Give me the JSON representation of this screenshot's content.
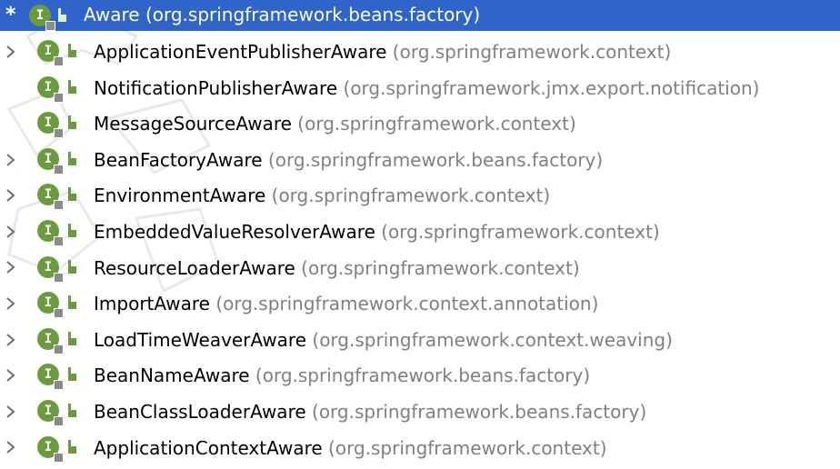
{
  "colors": {
    "selection": "#2f65ca",
    "interface_icon": "#6a9b3c",
    "package_text": "#808080"
  },
  "icons": {
    "chevron": "chevron-right-icon",
    "interface": "interface-icon",
    "visibility": "public-visibility-icon",
    "root_marker": "asterisk-icon"
  },
  "root": {
    "marker": "*",
    "icon_letter": "I",
    "name": "Aware",
    "package": "(org.springframework.beans.factory)"
  },
  "items": [
    {
      "has_children": true,
      "name": "ApplicationEventPublisherAware",
      "package": "(org.springframework.context)"
    },
    {
      "has_children": false,
      "name": "NotificationPublisherAware",
      "package": "(org.springframework.jmx.export.notification)"
    },
    {
      "has_children": false,
      "name": "MessageSourceAware",
      "package": "(org.springframework.context)"
    },
    {
      "has_children": true,
      "name": "BeanFactoryAware",
      "package": "(org.springframework.beans.factory)"
    },
    {
      "has_children": true,
      "name": "EnvironmentAware",
      "package": "(org.springframework.context)"
    },
    {
      "has_children": true,
      "name": "EmbeddedValueResolverAware",
      "package": "(org.springframework.context)"
    },
    {
      "has_children": true,
      "name": "ResourceLoaderAware",
      "package": "(org.springframework.context)"
    },
    {
      "has_children": true,
      "name": "ImportAware",
      "package": "(org.springframework.context.annotation)"
    },
    {
      "has_children": true,
      "name": "LoadTimeWeaverAware",
      "package": "(org.springframework.context.weaving)"
    },
    {
      "has_children": true,
      "name": "BeanNameAware",
      "package": "(org.springframework.beans.factory)"
    },
    {
      "has_children": true,
      "name": "BeanClassLoaderAware",
      "package": "(org.springframework.beans.factory)"
    },
    {
      "has_children": true,
      "name": "ApplicationContextAware",
      "package": "(org.springframework.context)"
    }
  ]
}
